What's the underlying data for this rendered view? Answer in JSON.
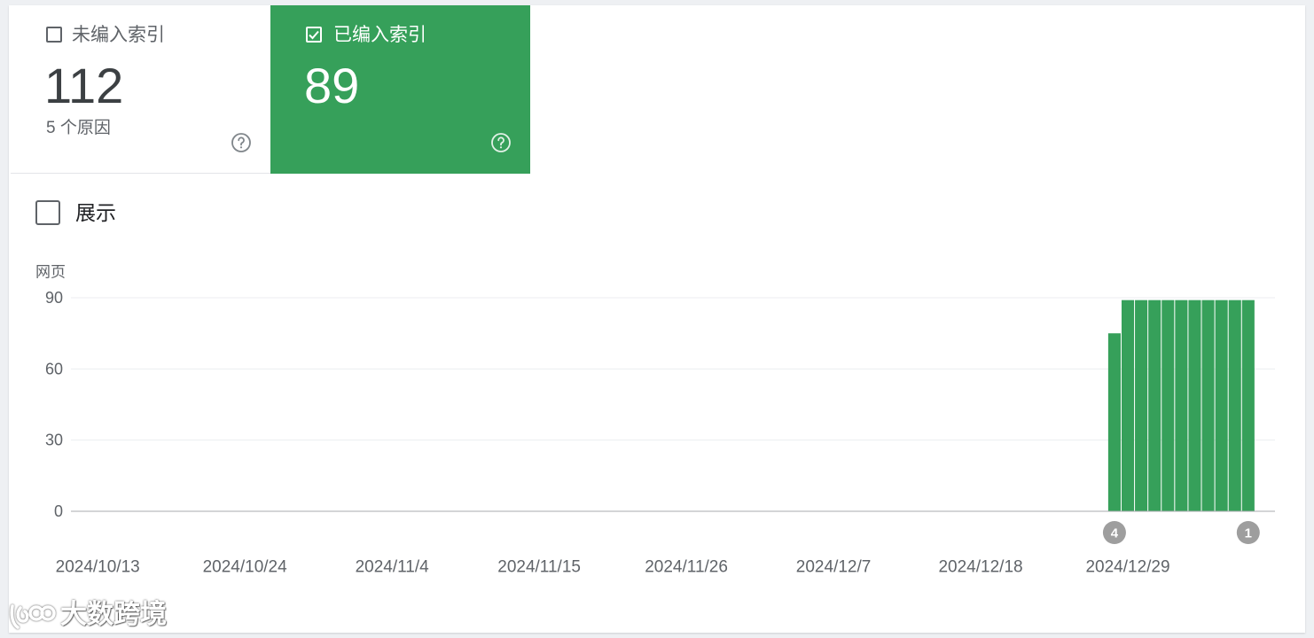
{
  "tiles": [
    {
      "label": "未编入索引",
      "value": 112,
      "subtitle": "5 个原因",
      "checked": false,
      "help_icon": "help-circle-icon"
    },
    {
      "label": "已编入索引",
      "value": 89,
      "checked": true,
      "help_icon": "help-circle-icon"
    }
  ],
  "show_toggle": {
    "label": "展示",
    "checked": false
  },
  "watermark": {
    "text": "大数跨境"
  },
  "colors": {
    "indexed": "#36a05a",
    "annotation_marker": "#9e9e9e"
  },
  "chart_data": {
    "type": "bar",
    "ylabel": "网页",
    "ylim": [
      0,
      90
    ],
    "yticks": [
      0,
      30,
      60,
      90
    ],
    "xlim": [
      "2024/10/11",
      "2025/1/9"
    ],
    "xticks": [
      "2024/10/13",
      "2024/10/24",
      "2024/11/4",
      "2024/11/15",
      "2024/11/26",
      "2024/12/7",
      "2024/12/18",
      "2024/12/29"
    ],
    "grid": true,
    "x": [
      "2024/12/28",
      "2024/12/29",
      "2024/12/30",
      "2024/12/31",
      "2025/1/1",
      "2025/1/2",
      "2025/1/3",
      "2025/1/4",
      "2025/1/5",
      "2025/1/6",
      "2025/1/7"
    ],
    "series": [
      {
        "color": "#36a05a",
        "values": [
          75,
          89,
          89,
          89,
          89,
          89,
          89,
          89,
          89,
          89,
          89
        ]
      }
    ],
    "annotations": [
      {
        "x": "2024/12/28",
        "label": "4"
      },
      {
        "x": "2025/1/7",
        "label": "1"
      }
    ]
  }
}
